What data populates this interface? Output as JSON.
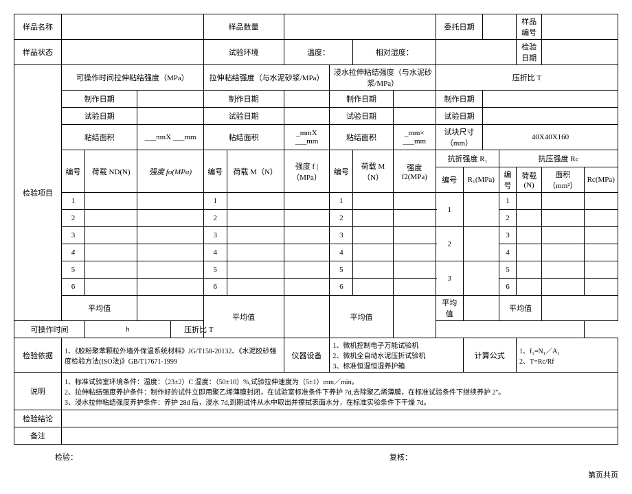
{
  "hdr": {
    "sampleName": "样品名称",
    "sampleQty": "样品数量",
    "entrustDate": "委托日期",
    "sampleNo": "样品编号",
    "sampleState": "样品状态",
    "testEnv": "试验环境",
    "temp": "温度：",
    "relHum": "相对湿度：",
    "inspectDate": "检验日期"
  },
  "row3": {
    "testItems": "检验项目",
    "opTimeTensile": "可操作时间拉伸粘结强度（MPa）",
    "tensile": "拉伸粘结强度（与水泥砂浆/MPa）",
    "soakTensile": "浸水拉伸粘结强度（与水泥砂浆/MPa）",
    "ratio": "压折比 T"
  },
  "row4": {
    "makeDate": "制作日期",
    "testDate": "试验日期",
    "bondArea": "粘结面积",
    "bondVal1": "___πmX ___mm",
    "bondVal2": "_mmX ___mm",
    "bondVal3": "_mm× ___mm",
    "specSize": "试块尺寸（mm）",
    "specVal": "40X40X160"
  },
  "row7": {
    "no": "编号",
    "loadN": "荷载 ND(N)",
    "strength0": "强度 fo(MPa)",
    "loadM": "荷载 M（N）",
    "strengthF": "强度 f |（MPa）",
    "loadM2": "荷载 M（N）",
    "strengthF2": "强度 f2(MPa)",
    "flexR": "抗折强度 R₁",
    "compRc": "抗压强度 Rc",
    "r1": "R₁(MPa)",
    "loadNs": "荷载(N)",
    "area": "面积（mm²）",
    "rmpa": "Rc(MPa)"
  },
  "nums": [
    "1",
    "2",
    "3",
    "4",
    "5",
    "6"
  ],
  "big": [
    "1",
    "2",
    "3"
  ],
  "avg": "平均值",
  "opTime": "可操作时间",
  "opUnit": "h",
  "ratioT": "压折比 T",
  "basis": {
    "label": "检验依据",
    "text": "1、《胶粉聚苯颗粒外墙外保温系统材料》JG/T158-20132、《水泥胶砂强度检验方法(ISO法)》GB/T17671-1999",
    "equip": "仪器设备",
    "equipList": "1、微机控制电子万能试验机\n2、微机全自动水泥压折试验机\n3、标准恒温恒湿养护箱",
    "formula": "计算公式",
    "formulaText": "1、f₁=N₁／A₁\n2、T=Rc/Rf"
  },
  "note": {
    "label": "说明",
    "text": "1、标准试验室环境条件：温度：（23±2）C 湿度：（50±10）%,试验拉伸速度为（5±1）mm／min。\n2、拉伸粘结强度养护条件：制作好的试件立即用聚乙烯薄膜封闭，在试验室标准条件下养护 7d,去除聚乙烯薄膜，在标准试验条件下继续养护 2''。\n3、浸水拉伸粘结强度养护条件：养护 28d 后，浸水 7d,到期试件从水中取出并擦拭表面水分，在标准实验条件下干燥 7d。"
  },
  "concl": "检验结论",
  "remark": "备注",
  "foot": {
    "inspect": "检验：",
    "review": "复核：",
    "page": "第页共页"
  }
}
